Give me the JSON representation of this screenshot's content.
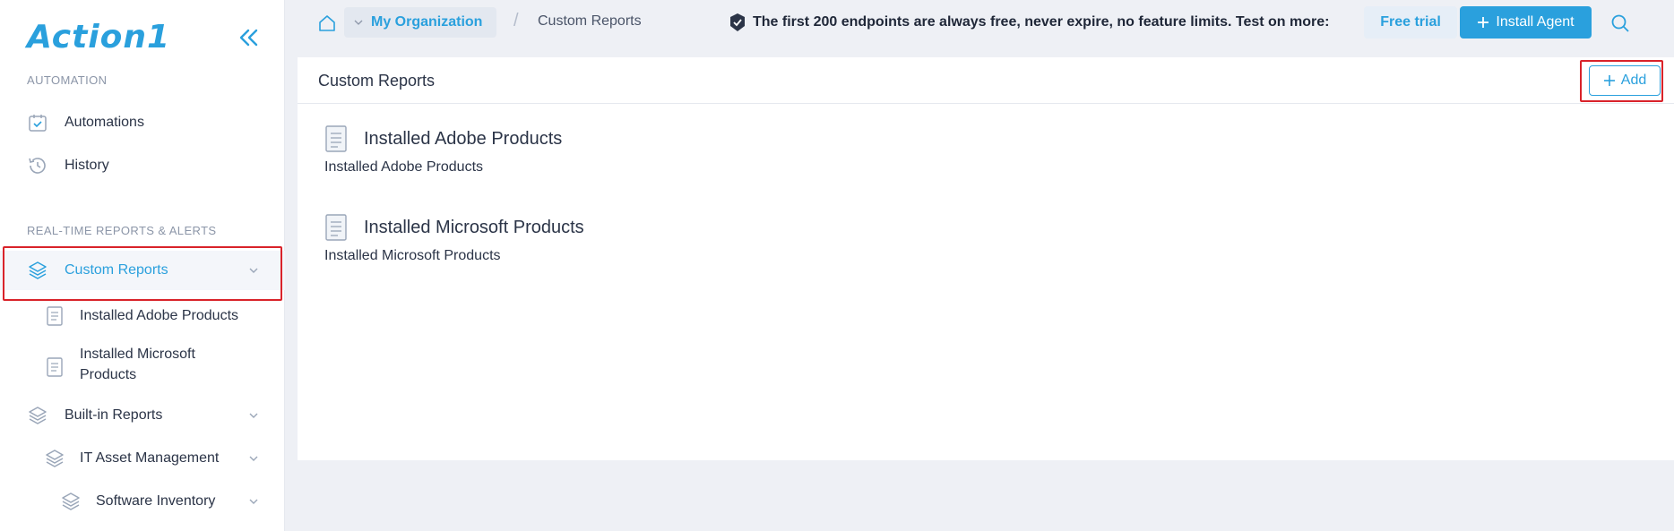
{
  "app": {
    "logo_text": "Action1"
  },
  "sidebar": {
    "sections": {
      "automation": "AUTOMATION",
      "reports": "REAL-TIME REPORTS & ALERTS"
    },
    "items": {
      "automations": "Automations",
      "history": "History",
      "custom_reports": "Custom Reports",
      "installed_adobe": "Installed Adobe Products",
      "installed_microsoft_line1": "Installed Microsoft",
      "installed_microsoft_line2": "Products",
      "builtin_reports": "Built-in Reports",
      "it_asset_management": "IT Asset Management",
      "software_inventory": "Software Inventory"
    }
  },
  "topbar": {
    "organization": "My Organization",
    "breadcrumb_separator": "/",
    "breadcrumb_current": "Custom Reports",
    "promo_text": "The first 200 endpoints are always free, never expire, no feature limits. Test on more:",
    "free_trial_label": "Free trial",
    "install_agent_label": "Install Agent"
  },
  "main": {
    "title": "Custom Reports",
    "add_label": "Add",
    "reports": [
      {
        "title": "Installed Adobe Products",
        "description": "Installed Adobe Products"
      },
      {
        "title": "Installed Microsoft Products",
        "description": "Installed Microsoft Products"
      }
    ]
  },
  "colors": {
    "accent": "#2aa0dd",
    "highlight": "#d9232a",
    "background": "#eef0f5"
  },
  "icons": [
    "collapse-icon",
    "calendar-check-icon",
    "history-icon",
    "layers-icon",
    "document-icon",
    "chevron-down-icon",
    "home-icon",
    "shield-check-icon",
    "plus-icon",
    "search-icon"
  ]
}
